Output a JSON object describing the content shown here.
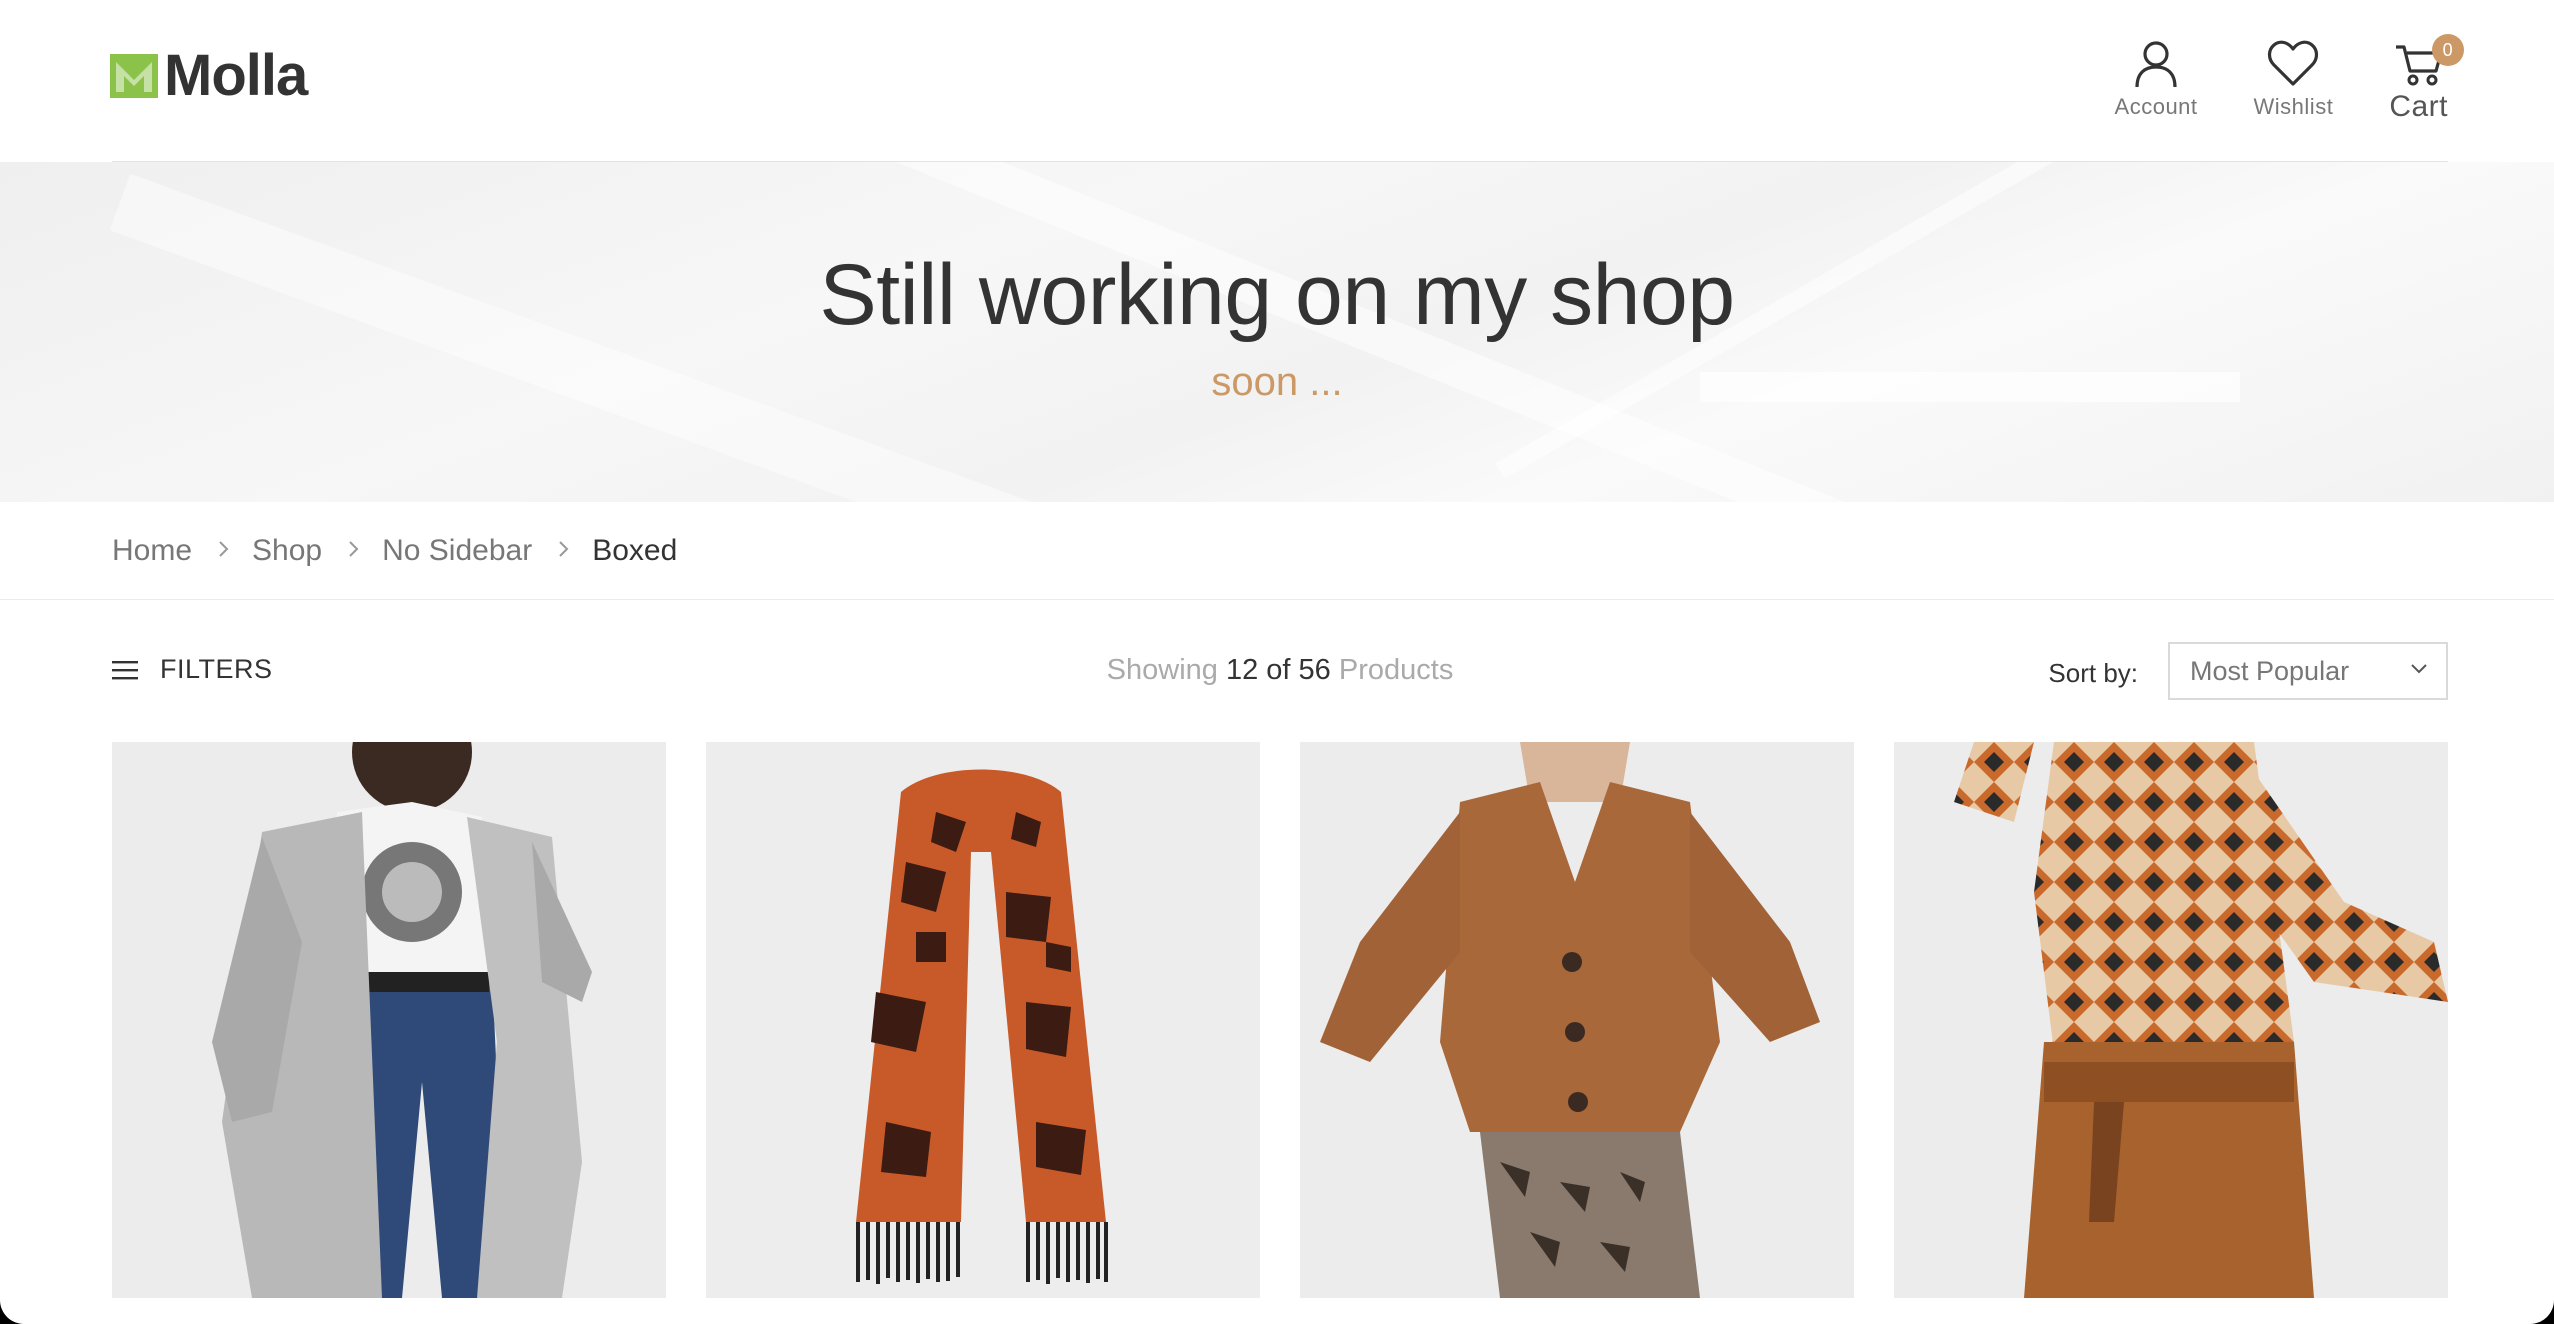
{
  "brand": {
    "name": "Molla",
    "accent": "#c96",
    "logo_green": "#8bc34a"
  },
  "header": {
    "account_label": "Account",
    "wishlist_label": "Wishlist",
    "cart_label": "Cart",
    "cart_count": "0"
  },
  "hero": {
    "title": "Still working on my shop",
    "subtitle": "soon ..."
  },
  "breadcrumb": [
    "Home",
    "Shop",
    "No Sidebar",
    "Boxed"
  ],
  "toolbar": {
    "filters_label": "FILTERS",
    "showing_prefix": "Showing",
    "showing_count": "12 of 56",
    "showing_suffix": "Products",
    "sort_label": "Sort by:",
    "sort_value": "Most Popular"
  },
  "products": [
    {
      "image": "grey-cable-knit-cardigan"
    },
    {
      "image": "snake-print-scarf"
    },
    {
      "image": "brown-button-cardigan"
    },
    {
      "image": "geometric-print-turtleneck"
    }
  ]
}
